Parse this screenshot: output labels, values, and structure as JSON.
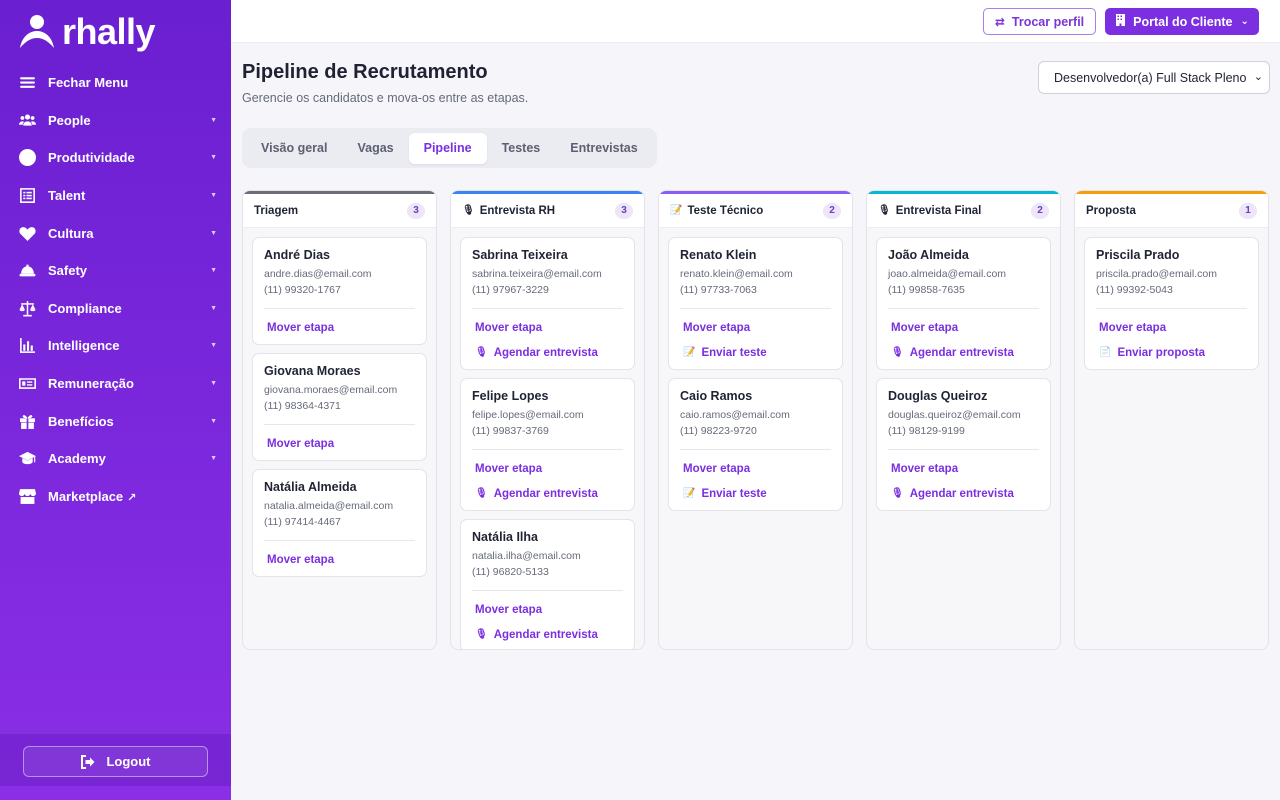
{
  "brand": {
    "name": "rhally"
  },
  "sidebar": {
    "items": [
      {
        "label": "Fechar Menu",
        "icon": "menu-icon",
        "caret": false
      },
      {
        "label": "People",
        "icon": "people-icon",
        "caret": true
      },
      {
        "label": "Produtividade",
        "icon": "clock-icon",
        "caret": true
      },
      {
        "label": "Talent",
        "icon": "list-icon",
        "caret": true
      },
      {
        "label": "Cultura",
        "icon": "heart-icon",
        "caret": true
      },
      {
        "label": "Safety",
        "icon": "helmet-icon",
        "caret": true
      },
      {
        "label": "Compliance",
        "icon": "scale-icon",
        "caret": true
      },
      {
        "label": "Intelligence",
        "icon": "chart-icon",
        "caret": true
      },
      {
        "label": "Remuneração",
        "icon": "money-icon",
        "caret": true
      },
      {
        "label": "Benefícios",
        "icon": "gift-icon",
        "caret": true
      },
      {
        "label": "Academy",
        "icon": "graduation-icon",
        "caret": true
      },
      {
        "label": "Marketplace",
        "icon": "store-icon",
        "caret": false,
        "external": "↗"
      }
    ],
    "logout": "Logout"
  },
  "topbar": {
    "trocar_perfil": "Trocar perfil",
    "portal": "Portal do Cliente"
  },
  "header": {
    "title": "Pipeline de Recrutamento",
    "subtitle": "Gerencie os candidatos e mova-os entre as etapas.",
    "job_select": "Desenvolvedor(a) Full Stack Pleno"
  },
  "tabs": [
    {
      "label": "Visão geral",
      "active": false
    },
    {
      "label": "Vagas",
      "active": false
    },
    {
      "label": "Pipeline",
      "active": true
    },
    {
      "label": "Testes",
      "active": false
    },
    {
      "label": "Entrevistas",
      "active": false
    }
  ],
  "columns": [
    {
      "title": "Triagem",
      "count": "3",
      "color": "#6b6e78",
      "icon": "",
      "cards": [
        {
          "name": "André Dias",
          "email": "andre.dias@email.com",
          "phone": "(11) 99320-1767",
          "actions": [
            {
              "label": "Mover etapa",
              "icon": ""
            }
          ]
        },
        {
          "name": "Giovana Moraes",
          "email": "giovana.moraes@email.com",
          "phone": "(11) 98364-4371",
          "actions": [
            {
              "label": "Mover etapa",
              "icon": ""
            }
          ]
        },
        {
          "name": "Natália Almeida",
          "email": "natalia.almeida@email.com",
          "phone": "(11) 97414-4467",
          "actions": [
            {
              "label": "Mover etapa",
              "icon": ""
            }
          ]
        }
      ]
    },
    {
      "title": "Entrevista RH",
      "count": "3",
      "color": "#3b82f6",
      "icon": "🎙",
      "cards": [
        {
          "name": "Sabrina Teixeira",
          "email": "sabrina.teixeira@email.com",
          "phone": "(11) 97967-3229",
          "actions": [
            {
              "label": "Mover etapa",
              "icon": ""
            },
            {
              "label": "Agendar entrevista",
              "icon": "🎙"
            }
          ]
        },
        {
          "name": "Felipe Lopes",
          "email": "felipe.lopes@email.com",
          "phone": "(11) 99837-3769",
          "actions": [
            {
              "label": "Mover etapa",
              "icon": ""
            },
            {
              "label": "Agendar entrevista",
              "icon": "🎙"
            }
          ]
        },
        {
          "name": "Natália Ilha",
          "email": "natalia.ilha@email.com",
          "phone": "(11) 96820-5133",
          "actions": [
            {
              "label": "Mover etapa",
              "icon": ""
            },
            {
              "label": "Agendar entrevista",
              "icon": "🎙"
            }
          ]
        }
      ]
    },
    {
      "title": "Teste Técnico",
      "count": "2",
      "color": "#8b5cf6",
      "icon": "📝",
      "cards": [
        {
          "name": "Renato Klein",
          "email": "renato.klein@email.com",
          "phone": "(11) 97733-7063",
          "actions": [
            {
              "label": "Mover etapa",
              "icon": ""
            },
            {
              "label": "Enviar teste",
              "icon": "📝"
            }
          ]
        },
        {
          "name": "Caio Ramos",
          "email": "caio.ramos@email.com",
          "phone": "(11) 98223-9720",
          "actions": [
            {
              "label": "Mover etapa",
              "icon": ""
            },
            {
              "label": "Enviar teste",
              "icon": "📝"
            }
          ]
        }
      ]
    },
    {
      "title": "Entrevista Final",
      "count": "2",
      "color": "#06b6d4",
      "icon": "🎙",
      "cards": [
        {
          "name": "João Almeida",
          "email": "joao.almeida@email.com",
          "phone": "(11) 99858-7635",
          "actions": [
            {
              "label": "Mover etapa",
              "icon": ""
            },
            {
              "label": "Agendar entrevista",
              "icon": "🎙"
            }
          ]
        },
        {
          "name": "Douglas Queiroz",
          "email": "douglas.queiroz@email.com",
          "phone": "(11) 98129-9199",
          "actions": [
            {
              "label": "Mover etapa",
              "icon": ""
            },
            {
              "label": "Agendar entrevista",
              "icon": "🎙"
            }
          ]
        }
      ]
    },
    {
      "title": "Proposta",
      "count": "1",
      "color": "#f59e0b",
      "icon": "",
      "cards": [
        {
          "name": "Priscila Prado",
          "email": "priscila.prado@email.com",
          "phone": "(11) 99392-5043",
          "actions": [
            {
              "label": "Mover etapa",
              "icon": ""
            },
            {
              "label": "Enviar proposta",
              "icon": "📄"
            }
          ]
        }
      ]
    }
  ]
}
